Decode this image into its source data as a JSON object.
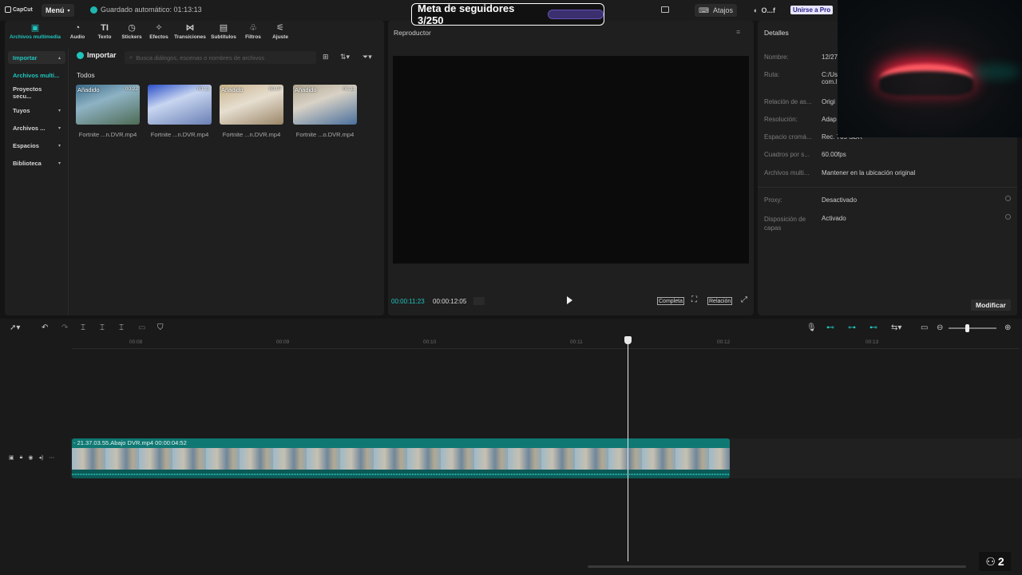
{
  "app": {
    "logo": "CapCut",
    "menu_label": "Menú",
    "autosave": "Guardado automático: 01:13:13"
  },
  "overlay": {
    "goal_text": "Meta de seguidores 3/250",
    "goal_progress": 0.012,
    "viewer_count": "2"
  },
  "topright": {
    "shortcuts_label": "Atajos",
    "user_label": "O...f",
    "pro_label": "Unirse a Pro"
  },
  "tools": [
    {
      "label": "Archivos multimedia",
      "icon": "media-icon"
    },
    {
      "label": "Audio",
      "icon": "audio-icon"
    },
    {
      "label": "Texto",
      "icon": "text-icon"
    },
    {
      "label": "Stickers",
      "icon": "sticker-icon"
    },
    {
      "label": "Efectos",
      "icon": "effects-icon"
    },
    {
      "label": "Transiciones",
      "icon": "transitions-icon"
    },
    {
      "label": "Subtítulos",
      "icon": "subtitles-icon"
    },
    {
      "label": "Filtros",
      "icon": "filters-icon"
    },
    {
      "label": "Ajuste",
      "icon": "adjust-icon"
    }
  ],
  "sidebar": {
    "items": [
      {
        "label": "Importar"
      },
      {
        "label": "Archivos multi..."
      },
      {
        "label": "Proyectos secu..."
      },
      {
        "label": "Tuyos"
      },
      {
        "label": "Archivos ..."
      },
      {
        "label": "Espacios"
      },
      {
        "label": "Biblioteca"
      }
    ]
  },
  "media": {
    "import_label": "Importar",
    "search_placeholder": "Busca diálogos, escenas o nombres de archivos",
    "section_label": "Todos",
    "files": [
      {
        "badge": "Añadido",
        "duration": "00:22",
        "name": "Fortnite ...n.DVR.mp4"
      },
      {
        "badge": "",
        "duration": "00:23",
        "name": "Fortnite ...n.DVR.mp4"
      },
      {
        "badge": "Añadido",
        "duration": "00:07",
        "name": "Fortnite ...n.DVR.mp4"
      },
      {
        "badge": "Añadido",
        "duration": "00:11",
        "name": "Fortnite ...o.DVR.mp4"
      }
    ]
  },
  "player": {
    "title": "Reproductor",
    "current_time": "00:00:11:23",
    "total_time": "00:00:12:05",
    "full_label": "Completa",
    "ratio_label": "Relación"
  },
  "details": {
    "title": "Detalles",
    "rows": [
      {
        "label": "Nombre:",
        "value": "12/27"
      },
      {
        "label": "Ruta:",
        "value": "C:/Us com.l"
      },
      {
        "label": "Relación de as...",
        "value": "Origi"
      },
      {
        "label": "Resolución:",
        "value": "Adap"
      },
      {
        "label": "Espacio cromá...",
        "value": "Rec. 709 SDR"
      },
      {
        "label": "Cuadros por s...",
        "value": "60.00fps"
      },
      {
        "label": "Archivos multi...",
        "value": "Mantener en la ubicación original"
      },
      {
        "label": "Proxy:",
        "value": "Desactivado"
      },
      {
        "label": "Disposición de capas",
        "value": "Activado"
      }
    ],
    "modify_label": "Modificar"
  },
  "timeline": {
    "ticks": [
      "00:08",
      "00:09",
      "00:10",
      "00:11",
      "00:12",
      "00:13"
    ],
    "clip_label": "- 21.37.03.55.Abajo DVR.mp4  00:00:04:52"
  }
}
